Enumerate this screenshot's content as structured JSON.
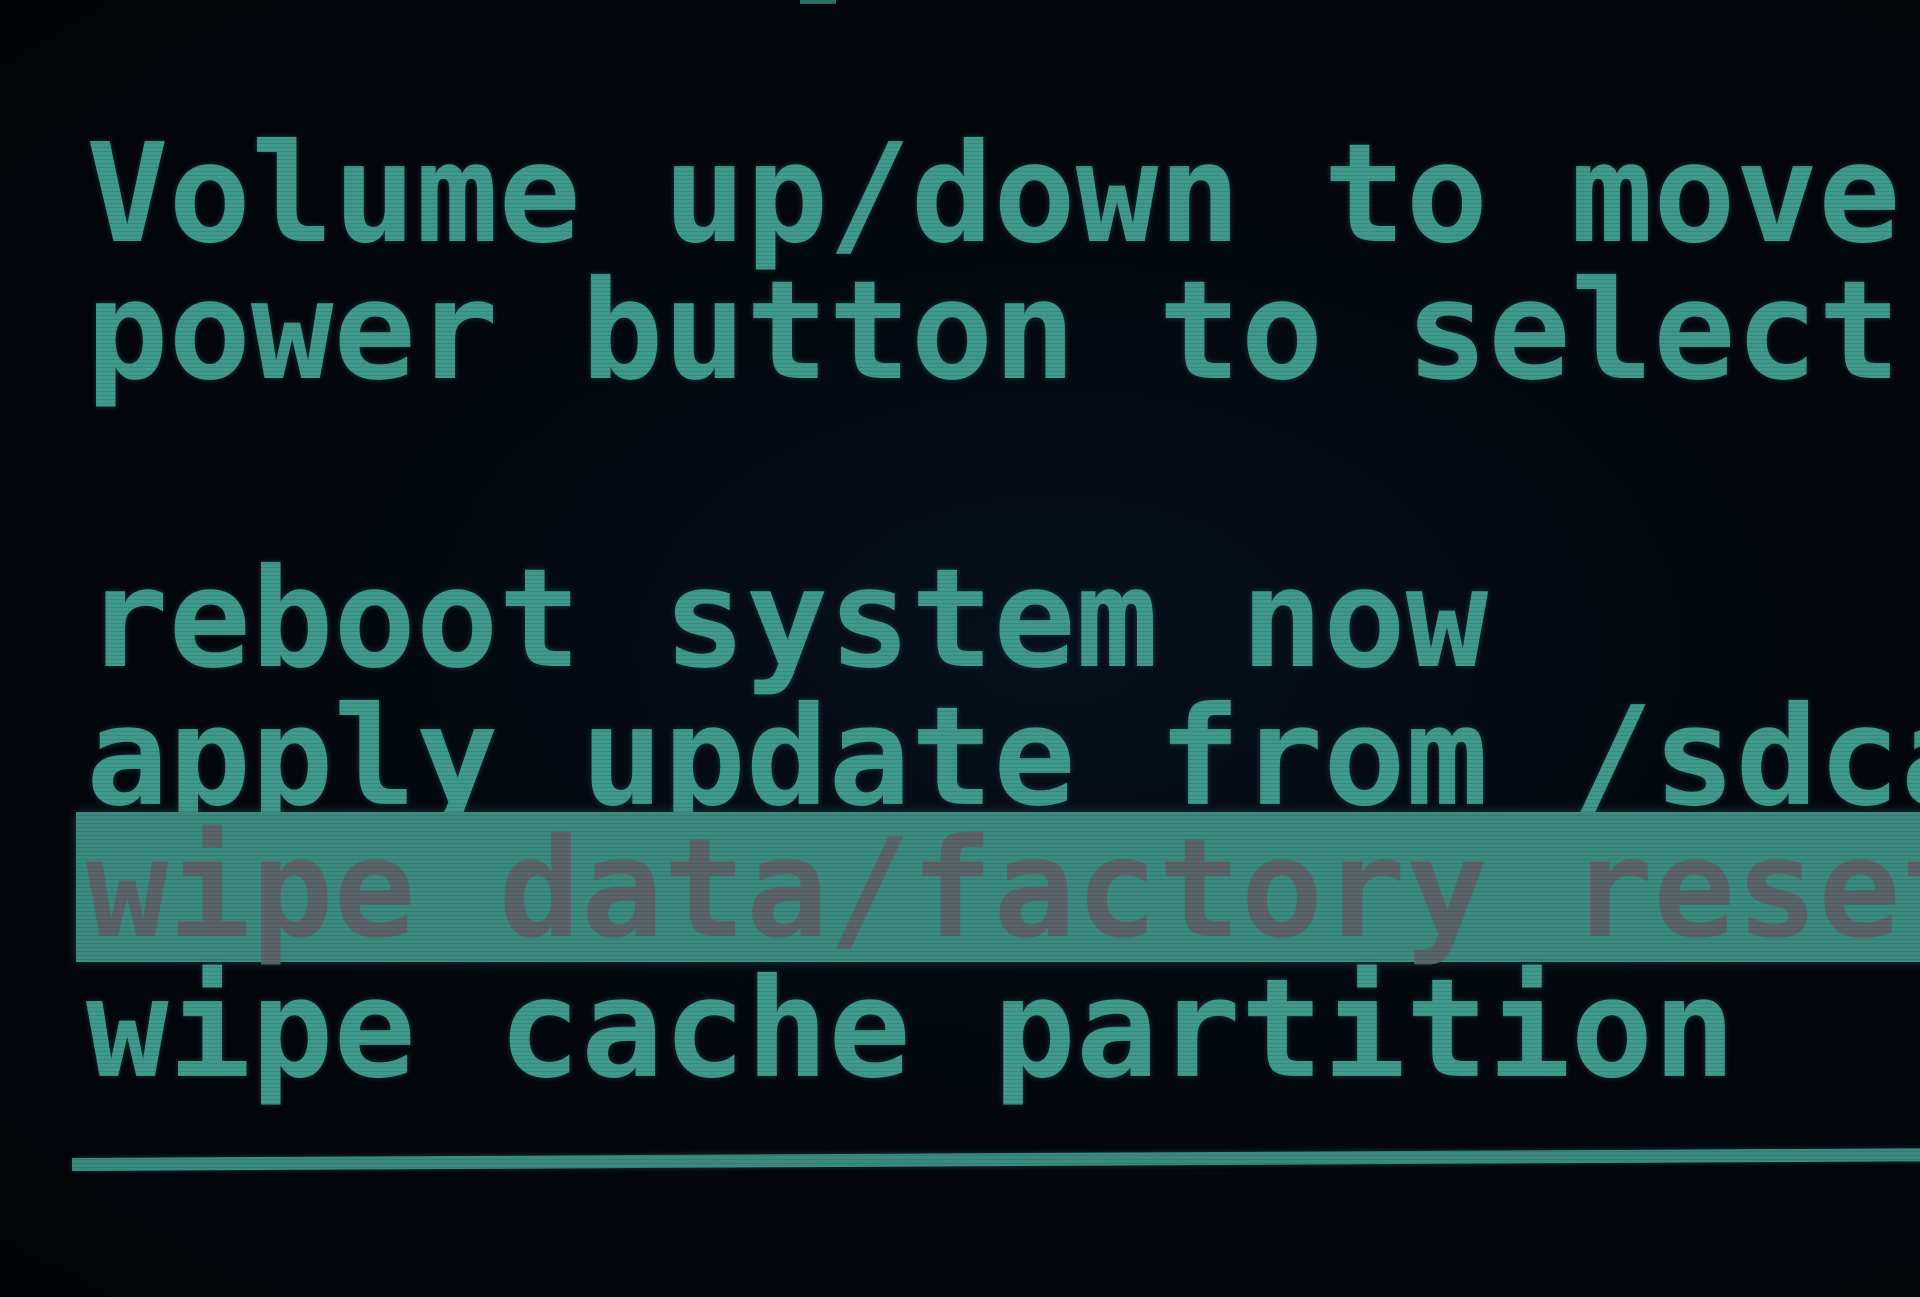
{
  "recovery": {
    "instructions": {
      "line1": "Volume up/down to move h",
      "line2": "power button to select."
    },
    "menu": {
      "items": [
        {
          "label": "reboot system now"
        },
        {
          "label": "apply update from /sdcar"
        },
        {
          "label": "wipe data/factory reset"
        },
        {
          "label": "wipe cache partition"
        }
      ],
      "selected_index": 2
    }
  },
  "colors": {
    "text": "#3f9a8c",
    "highlight_bg": "#3a8a7e",
    "highlight_text": "#5b6468",
    "background": "#030509"
  }
}
